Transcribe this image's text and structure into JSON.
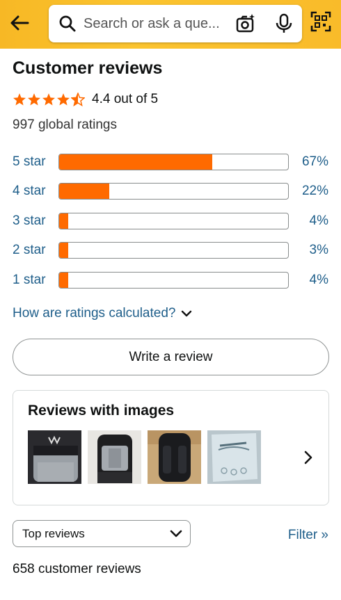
{
  "search": {
    "placeholder": "Search or ask a que..."
  },
  "reviews": {
    "title": "Customer reviews",
    "rating_value": 4.4,
    "rating_text": "4.4 out of 5",
    "global_ratings": "997 global ratings",
    "histogram": [
      {
        "label": "5 star",
        "percent_text": "67%",
        "fraction": 0.67
      },
      {
        "label": "4 star",
        "percent_text": "22%",
        "fraction": 0.22
      },
      {
        "label": "3 star",
        "percent_text": "4%",
        "fraction": 0.04
      },
      {
        "label": "2 star",
        "percent_text": "3%",
        "fraction": 0.03
      },
      {
        "label": "1 star",
        "percent_text": "4%",
        "fraction": 0.04
      }
    ],
    "how_calculated": "How are ratings calculated?",
    "write_review": "Write a review",
    "images_title": "Reviews with images",
    "sort_selected": "Top reviews",
    "filter_label": "Filter »",
    "customer_reviews_count": "658 customer reviews"
  },
  "colors": {
    "header": "#f9bb2a",
    "star": "#ff6a00",
    "bar_fill": "#ff6a00",
    "link": "#1e5e8a"
  },
  "icons": [
    "back-arrow-icon",
    "search-icon",
    "camera-icon",
    "mic-icon",
    "barcode-scan-icon",
    "star-icon",
    "chevron-down-icon",
    "chevron-right-icon"
  ]
}
